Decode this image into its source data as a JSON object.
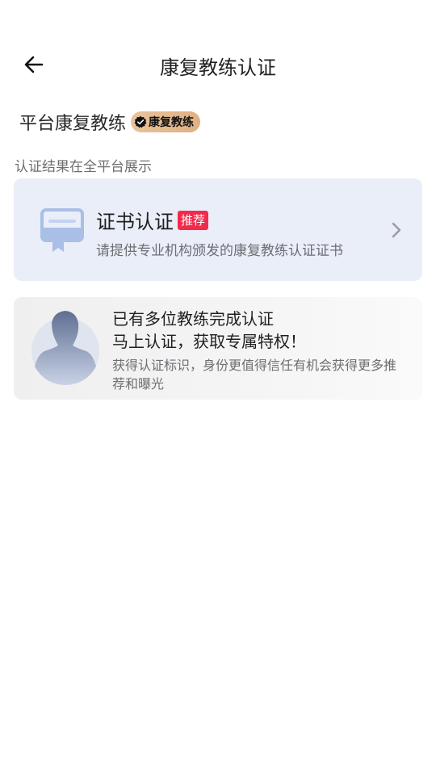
{
  "header": {
    "title": "康复教练认证",
    "back_icon": "arrow-left-icon"
  },
  "role": {
    "text": "平台康复教练",
    "badge_label": "康复教练",
    "badge_icon": "verified-check-icon"
  },
  "section_label": "认证结果在全平台展示",
  "cert_card": {
    "title": "证书认证",
    "tag": "推荐",
    "description": "请提供专业机构颁发的康复教练认证证书",
    "icon": "certificate-icon",
    "chevron_icon": "chevron-right-icon"
  },
  "promo_card": {
    "line1": "已有多位教练完成认证",
    "line2": "马上认证，获取专属特权！",
    "description": "获得认证标识，身份更值得信任有机会获得更多推荐和曝光",
    "avatar_icon": "person-avatar-icon"
  },
  "colors": {
    "tag_red": "#f22b4a",
    "card_blue": "#e9eef8",
    "badge_gold": "#e8c39a",
    "icon_blue": "#a9bfe6"
  }
}
